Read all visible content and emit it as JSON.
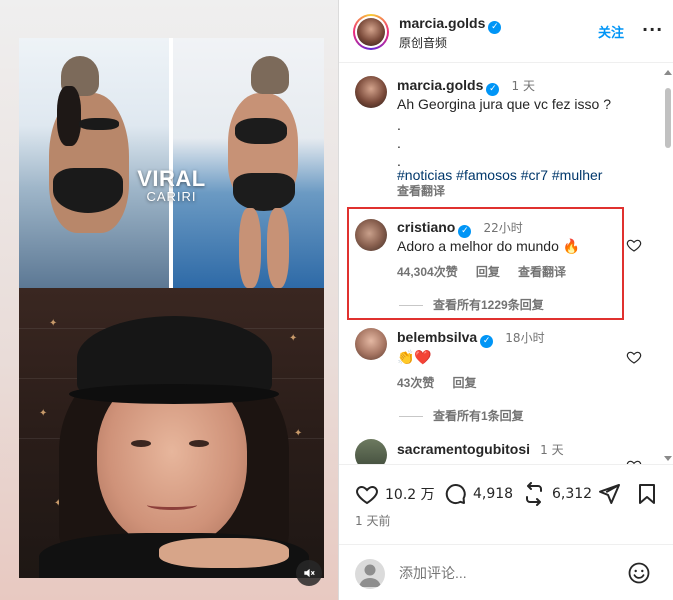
{
  "media": {
    "overlay_title": "VIRAL",
    "overlay_subtitle": "CARIRI",
    "mute_icon": "speaker-muted-icon"
  },
  "header": {
    "username": "marcia.golds",
    "subtitle": "原创音频",
    "follow_label": "关注",
    "more_label": "···"
  },
  "caption": {
    "username": "marcia.golds",
    "time": "1 天",
    "text": "Ah Georgina jura que vc fez isso ?",
    "dots": [
      ".",
      ".",
      "."
    ],
    "hashtags": [
      "#noticias",
      "#famosos",
      "#cr7",
      "#mulher"
    ],
    "translate": "查看翻译"
  },
  "comments": [
    {
      "username": "cristiano",
      "time": "22小时",
      "text": "Adoro a melhor do mundo",
      "emoji": "🔥",
      "likes": "44,304次赞",
      "reply": "回复",
      "translate": "查看翻译",
      "view_replies": "查看所有1229条回复"
    },
    {
      "username": "belembsilva",
      "time": "18小时",
      "text": "👏❤️",
      "likes": "43次赞",
      "reply": "回复",
      "view_replies": "查看所有1条回复"
    },
    {
      "username": "sacramentogubitosi",
      "time": "1 天"
    }
  ],
  "actions": {
    "likes": "10.2 万",
    "comments": "4,918",
    "reposts": "6,312",
    "posted": "1 天前"
  },
  "add_comment": {
    "placeholder": "添加评论..."
  },
  "colors": {
    "accent": "#0095f6",
    "highlight": "#e0312f",
    "heart_red": "#ed4956"
  }
}
